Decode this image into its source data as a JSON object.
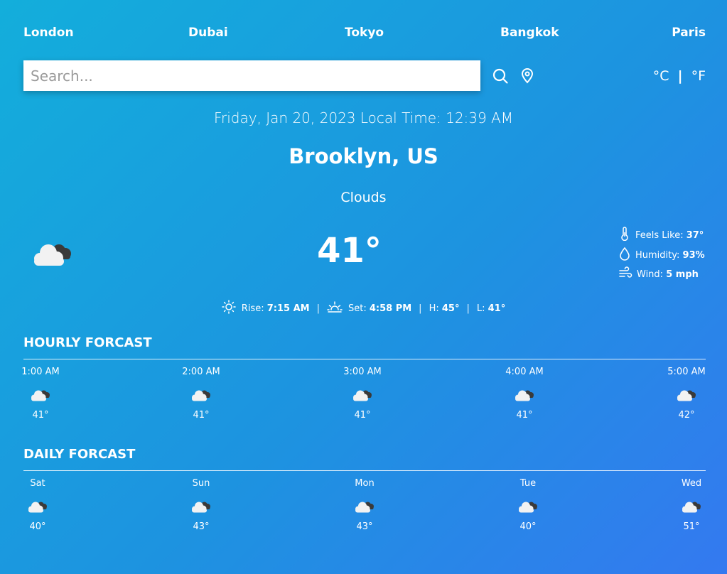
{
  "nav": {
    "cities": [
      "London",
      "Dubai",
      "Tokyo",
      "Bangkok",
      "Paris"
    ]
  },
  "search": {
    "placeholder": "Search...",
    "value": ""
  },
  "icons": {
    "search": "search-icon",
    "location": "location-pin-icon"
  },
  "units": {
    "celsius": "°C",
    "separator": "|",
    "fahrenheit": "°F"
  },
  "current": {
    "datetime": "Friday, Jan 20, 2023 Local Time: 12:39 AM",
    "location": "Brooklyn, US",
    "condition": "Clouds",
    "temperature": "41°",
    "icon": "clouds-icon",
    "details": {
      "feels_like_label": "Feels Like:",
      "feels_like_value": "37°",
      "humidity_label": "Humidity:",
      "humidity_value": "93%",
      "wind_label": "Wind:",
      "wind_value": "5 mph"
    },
    "sun": {
      "rise_label": "Rise:",
      "rise_value": "7:15 AM",
      "set_label": "Set:",
      "set_value": "4:58 PM",
      "high_label": "H:",
      "high_value": "45°",
      "low_label": "L:",
      "low_value": "41°",
      "separator": "|"
    }
  },
  "hourly": {
    "title": "HOURLY FORCAST",
    "items": [
      {
        "label": "1:00 AM",
        "temp": "41°"
      },
      {
        "label": "2:00 AM",
        "temp": "41°"
      },
      {
        "label": "3:00 AM",
        "temp": "41°"
      },
      {
        "label": "4:00 AM",
        "temp": "41°"
      },
      {
        "label": "5:00 AM",
        "temp": "42°"
      }
    ]
  },
  "daily": {
    "title": "DAILY FORCAST",
    "items": [
      {
        "label": "Sat",
        "temp": "40°"
      },
      {
        "label": "Sun",
        "temp": "43°"
      },
      {
        "label": "Mon",
        "temp": "43°"
      },
      {
        "label": "Tue",
        "temp": "40°"
      },
      {
        "label": "Wed",
        "temp": "51°"
      }
    ]
  }
}
